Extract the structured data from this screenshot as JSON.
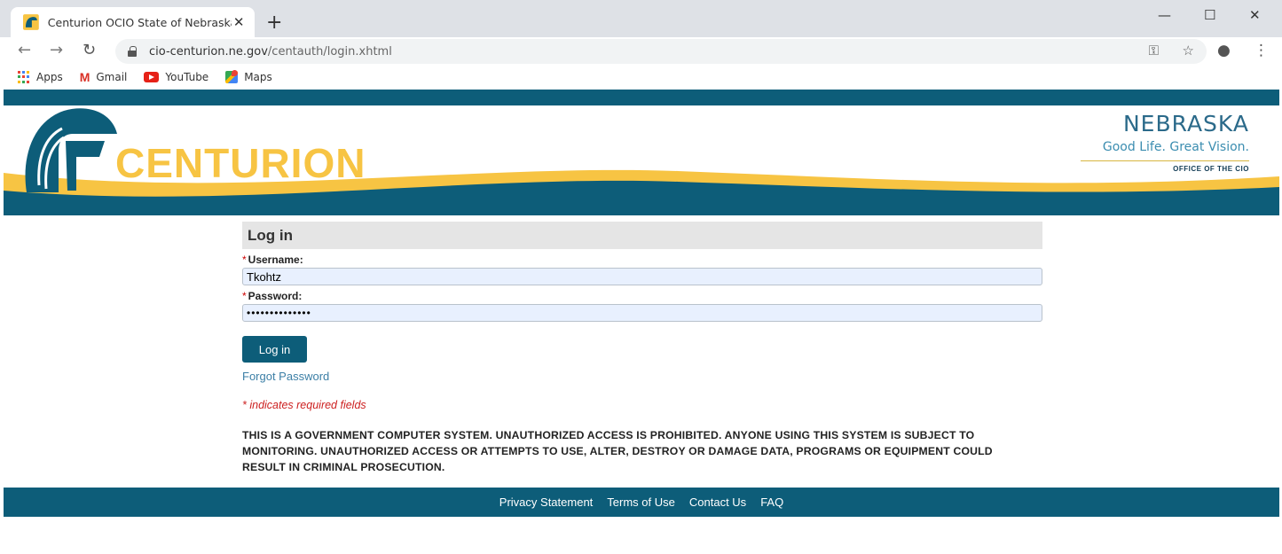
{
  "browser": {
    "tab_title": "Centurion OCIO State of Nebraska",
    "url_host": "cio-centurion.ne.gov",
    "url_path": "/centauth/login.xhtml",
    "bookmarks": [
      {
        "label": "Apps",
        "icon": "apps-grid-icon"
      },
      {
        "label": "Gmail",
        "icon": "gmail-icon"
      },
      {
        "label": "YouTube",
        "icon": "youtube-icon"
      },
      {
        "label": "Maps",
        "icon": "maps-icon"
      }
    ]
  },
  "header": {
    "logo_text": "CENTURION",
    "state_name": "NEBRASKA",
    "tagline": "Good Life. Great Vision.",
    "office": "OFFICE OF THE CIO"
  },
  "login": {
    "title": "Log in",
    "required_marker": "*",
    "username_label": "Username:",
    "username_value": "Tkohtz",
    "password_label": "Password:",
    "password_value": "••••••••••••••",
    "submit_label": "Log in",
    "forgot_label": "Forgot Password",
    "required_note": "* indicates required fields",
    "warning": "THIS IS A GOVERNMENT COMPUTER SYSTEM. UNAUTHORIZED ACCESS IS PROHIBITED. ANYONE USING THIS SYSTEM IS SUBJECT TO MONITORING. UNAUTHORIZED ACCESS OR ATTEMPTS TO USE, ALTER, DESTROY OR DAMAGE DATA, PROGRAMS OR EQUIPMENT COULD RESULT IN CRIMINAL PROSECUTION."
  },
  "footer": {
    "links": [
      "Privacy Statement",
      "Terms of Use",
      "Contact Us",
      "FAQ"
    ]
  },
  "colors": {
    "brand_teal": "#0d5d79",
    "brand_gold": "#f7c443",
    "required_red": "#cc1f1f",
    "link_blue": "#3c7fa6"
  }
}
